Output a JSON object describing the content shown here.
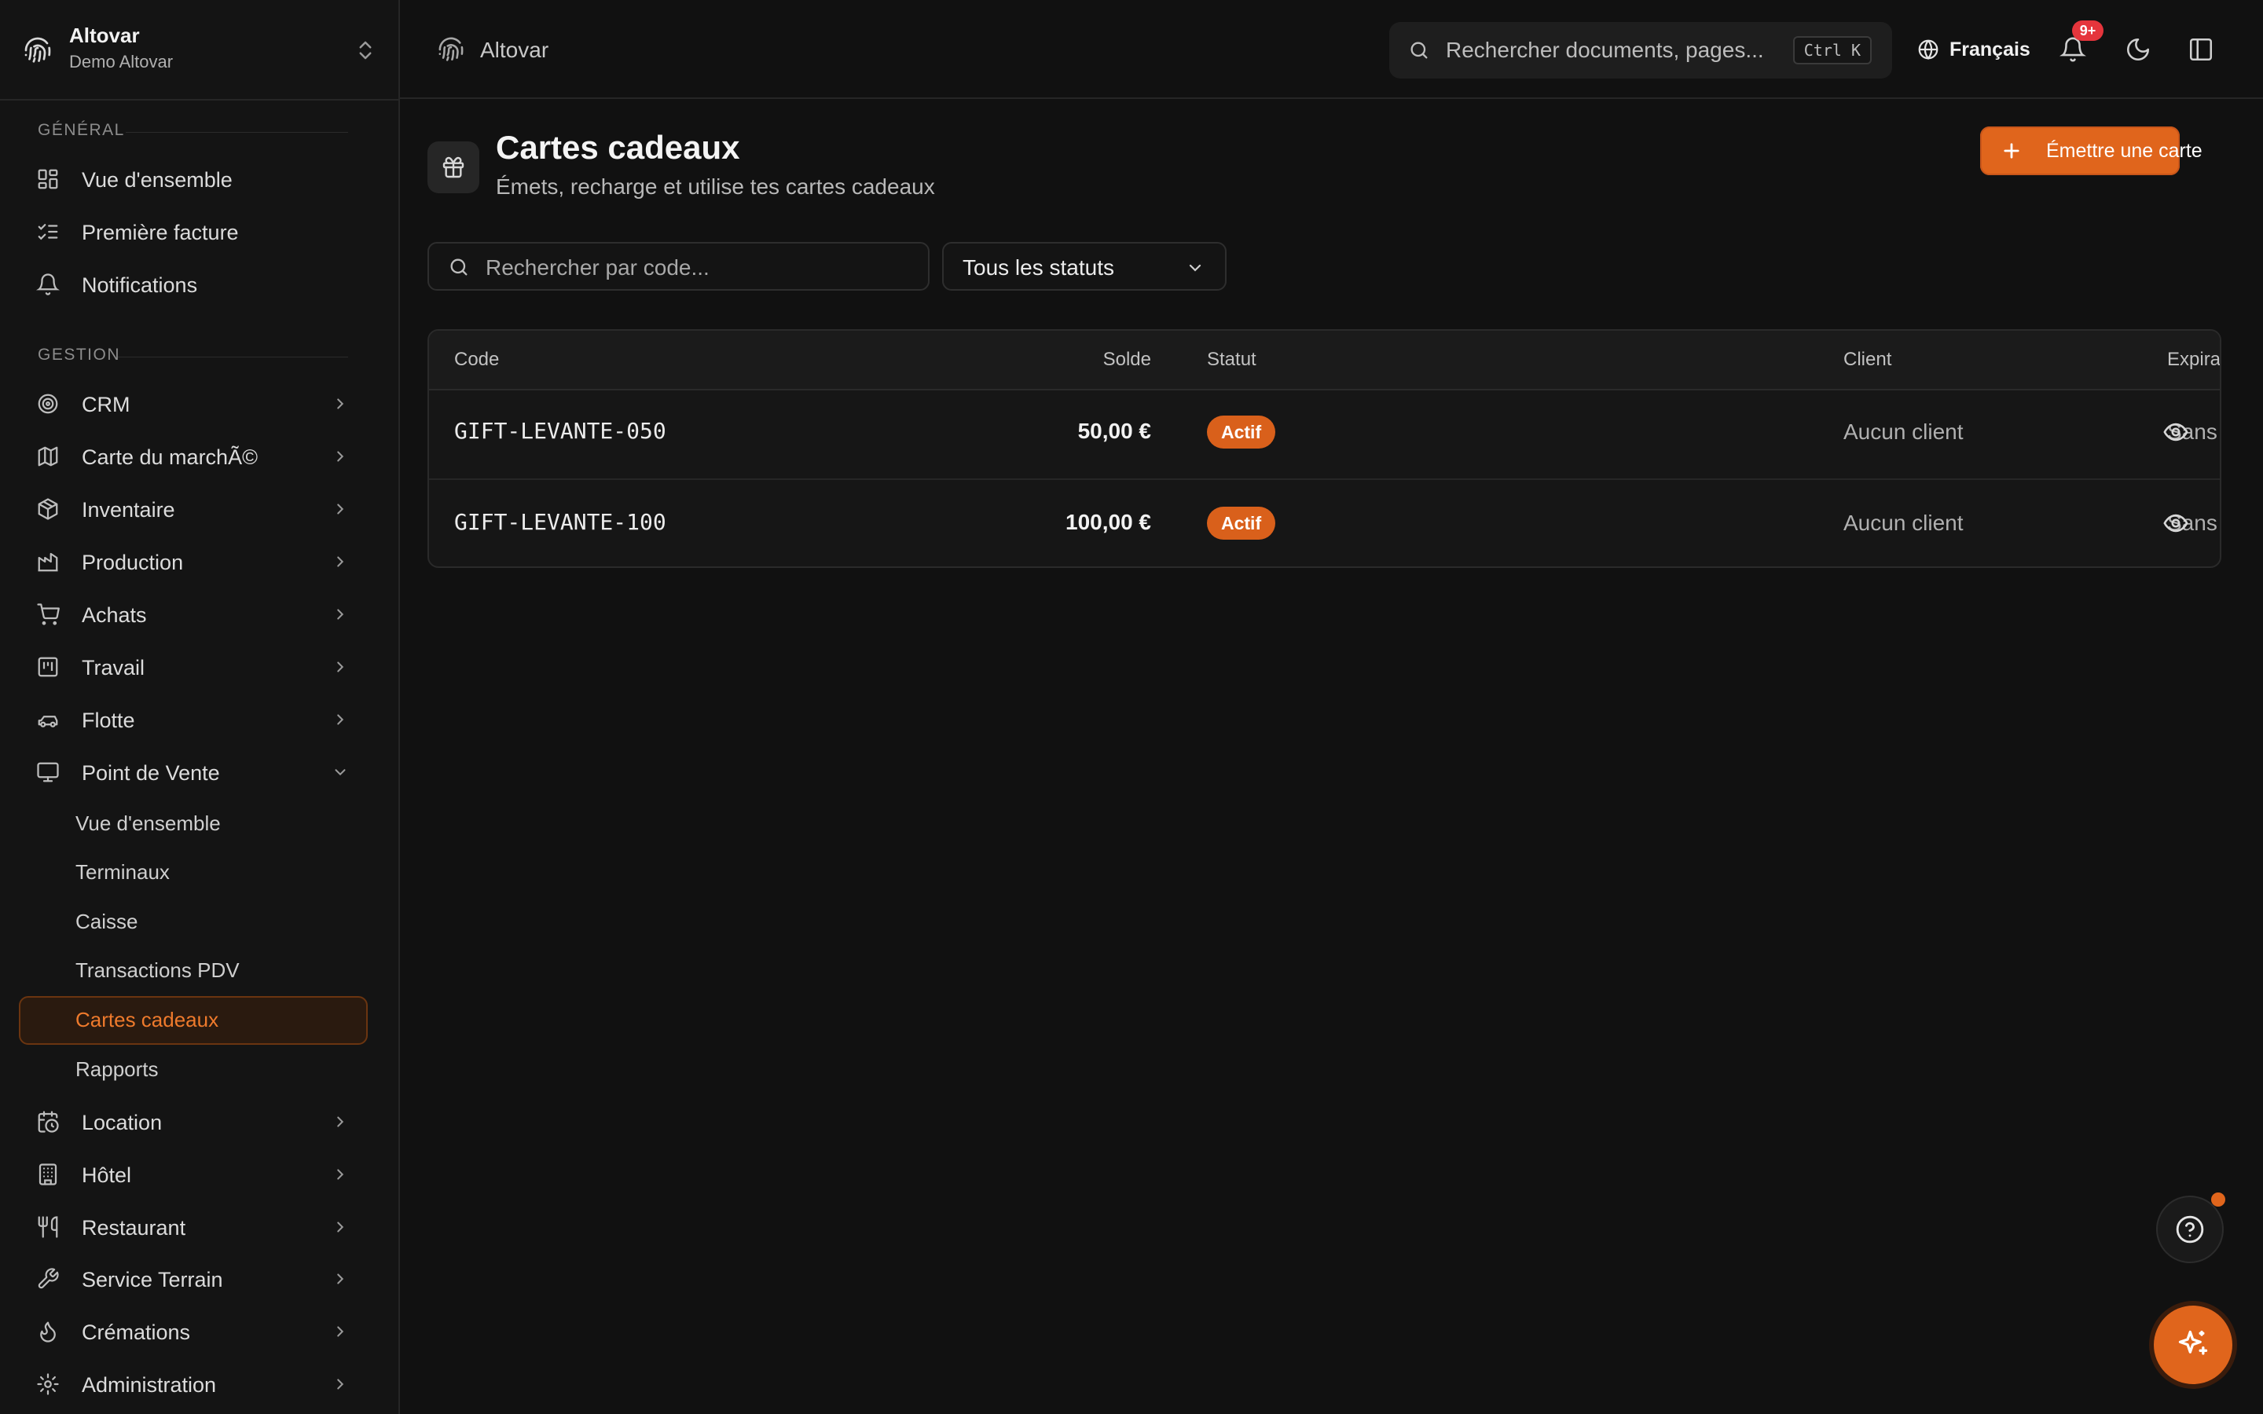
{
  "brand": {
    "name": "Altovar",
    "subtitle": "Demo Altovar"
  },
  "sidebar": {
    "sections": [
      {
        "label": "GÉNÉRAL"
      },
      {
        "label": "GESTION"
      }
    ],
    "general_items": [
      {
        "label": "Vue d'ensemble",
        "icon": "layout-dashboard-icon"
      },
      {
        "label": "Première facture",
        "icon": "list-checks-icon"
      },
      {
        "label": "Notifications",
        "icon": "bell-icon"
      }
    ],
    "gestion_items": [
      {
        "label": "CRM",
        "icon": "target-icon"
      },
      {
        "label": "Carte du marchÃ©",
        "icon": "map-icon"
      },
      {
        "label": "Inventaire",
        "icon": "package-icon"
      },
      {
        "label": "Production",
        "icon": "factory-icon"
      },
      {
        "label": "Achats",
        "icon": "cart-icon"
      },
      {
        "label": "Travail",
        "icon": "kanban-icon"
      },
      {
        "label": "Flotte",
        "icon": "car-icon"
      },
      {
        "label": "Point de Vente",
        "icon": "monitor-icon",
        "expanded": true
      }
    ],
    "pos_subitems": [
      {
        "label": "Vue d'ensemble"
      },
      {
        "label": "Terminaux"
      },
      {
        "label": "Caisse"
      },
      {
        "label": "Transactions PDV"
      },
      {
        "label": "Cartes cadeaux",
        "active": true
      },
      {
        "label": "Rapports"
      }
    ],
    "more_items": [
      {
        "label": "Location",
        "icon": "calendar-clock-icon"
      },
      {
        "label": "Hôtel",
        "icon": "building-icon"
      },
      {
        "label": "Restaurant",
        "icon": "utensils-icon"
      },
      {
        "label": "Service Terrain",
        "icon": "wrench-icon"
      },
      {
        "label": "Crémations",
        "icon": "flame-icon"
      },
      {
        "label": "Administration",
        "icon": "gear-icon"
      }
    ]
  },
  "topbar": {
    "app_name": "Altovar",
    "search_placeholder": "Rechercher documents, pages...",
    "search_shortcut": "Ctrl K",
    "language": "Français",
    "notifications_badge": "9+"
  },
  "page": {
    "title": "Cartes cadeaux",
    "subtitle": "Émets, recharge et utilise tes cartes cadeaux",
    "primary_action": "Émettre une carte",
    "filters": {
      "search_placeholder": "Rechercher par code...",
      "status_value": "Tous les statuts"
    },
    "table": {
      "columns": [
        "Code",
        "Solde",
        "Statut",
        "Client",
        "Expiration"
      ],
      "rows": [
        {
          "code": "GIFT-LEVANTE-050",
          "balance": "50,00 €",
          "status": "Actif",
          "client": "Aucun client",
          "expiration": "Sans expiration"
        },
        {
          "code": "GIFT-LEVANTE-100",
          "balance": "100,00 €",
          "status": "Actif",
          "client": "Aucun client",
          "expiration": "Sans expiration"
        }
      ]
    }
  },
  "colors": {
    "accent": "#e0651c",
    "background": "#111111",
    "sidebar": "#141414",
    "badge": "#e5353c"
  }
}
